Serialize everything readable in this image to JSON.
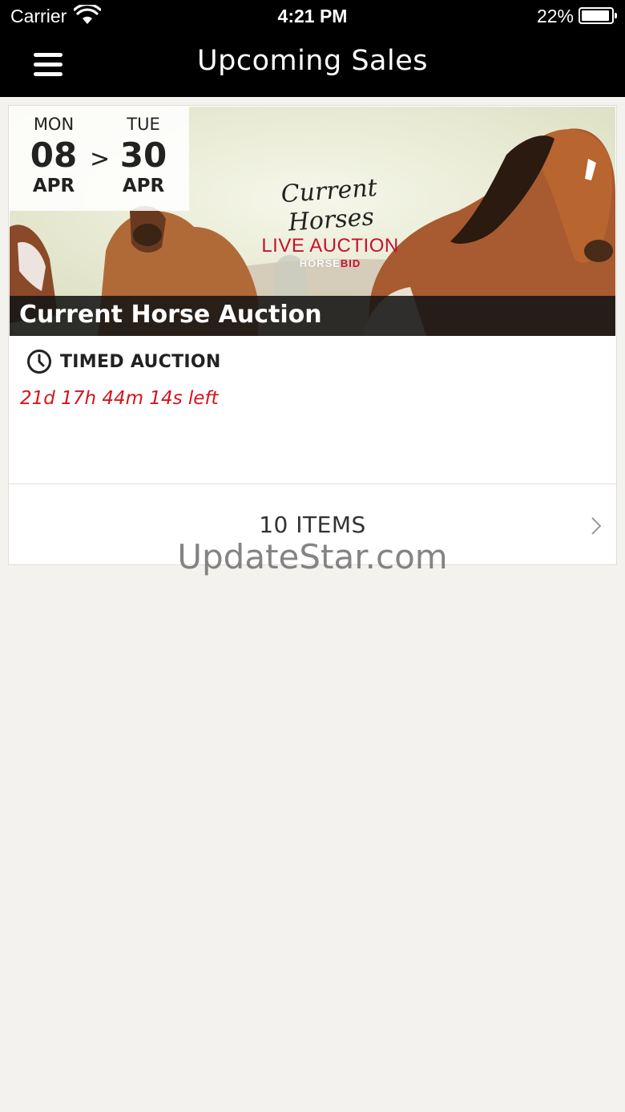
{
  "status_bar": {
    "carrier": "Carrier",
    "time": "4:21 PM",
    "battery": "22%"
  },
  "nav": {
    "title": "Upcoming Sales",
    "menu_icon": "hamburger-menu-icon"
  },
  "sale": {
    "start": {
      "dow": "MON",
      "day": "08",
      "month": "APR"
    },
    "arrow": ">",
    "end": {
      "dow": "TUE",
      "day": "30",
      "month": "APR"
    },
    "logo": {
      "script": "Current Horses",
      "live": "LIVE AUCTION",
      "brand_a": "HORSE",
      "brand_b": "BID"
    },
    "title": "Current Horse Auction",
    "type_icon": "clock-icon",
    "type_label": "TIMED AUCTION",
    "countdown": "21d 17h 44m 14s left",
    "items_label": "10 ITEMS",
    "chevron_icon": "chevron-right-icon"
  },
  "colors": {
    "bar": "#000000",
    "background": "#f3f2ee",
    "countdown": "#d6141c",
    "logo_red": "#c8102e"
  },
  "watermark": "UpdateStar.com"
}
